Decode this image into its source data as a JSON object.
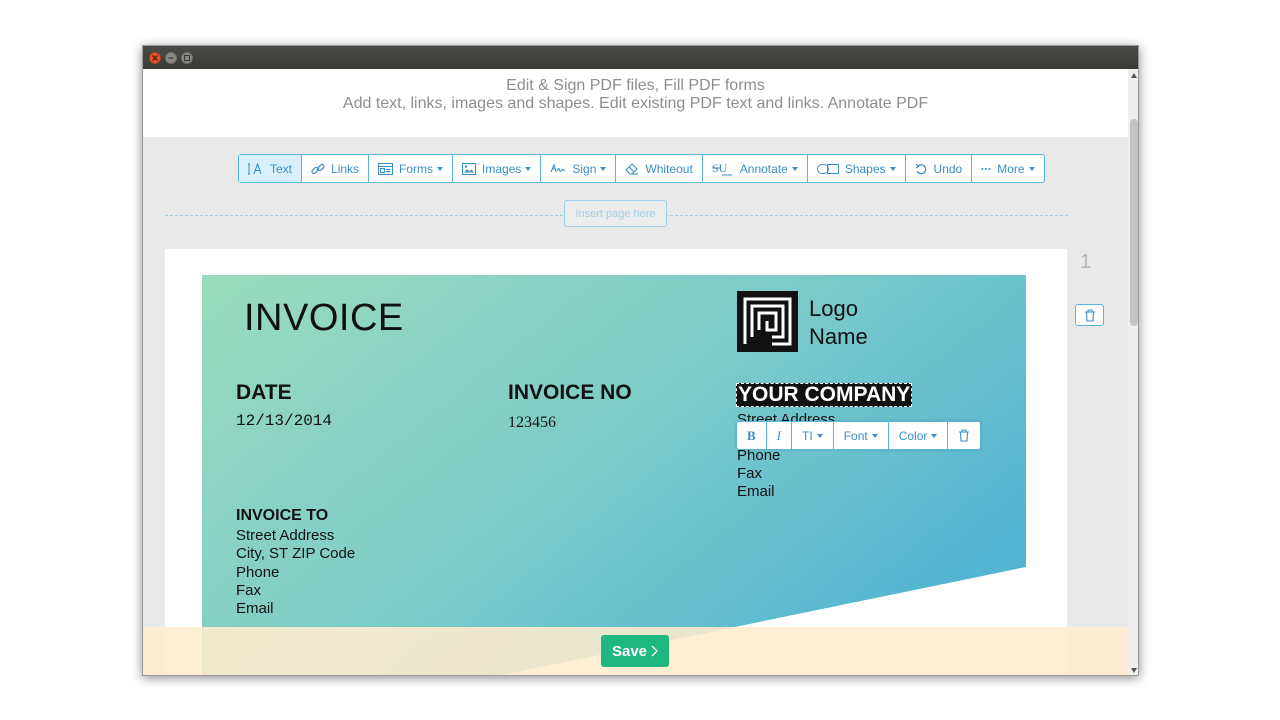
{
  "header": {
    "line1": "Edit & Sign PDF files, Fill PDF forms",
    "line2": "Add text, links, images and shapes. Edit existing PDF text and links. Annotate PDF"
  },
  "toolbar": {
    "text": "Text",
    "links": "Links",
    "forms": "Forms",
    "images": "Images",
    "sign": "Sign",
    "whiteout": "Whiteout",
    "annotate": "Annotate",
    "shapes": "Shapes",
    "undo": "Undo",
    "more": "More"
  },
  "insert_page": "Insert page here",
  "page": {
    "number": "1"
  },
  "invoice": {
    "title": "INVOICE",
    "logo_line1": "Logo",
    "logo_line2": "Name",
    "date_label": "DATE",
    "date_value": "12/13/2014",
    "invoice_no_label": "INVOICE NO",
    "invoice_no_value": "123456",
    "company": "YOUR COMPANY",
    "company_street": "Street Address",
    "company_phone": "Phone",
    "company_fax": "Fax",
    "company_email": "Email",
    "invoice_to_label": "INVOICE TO",
    "to_street": "Street Address",
    "to_city": "City, ST ZIP Code",
    "to_phone": "Phone",
    "to_fax": "Fax",
    "to_email": "Email"
  },
  "format_bar": {
    "bold": "B",
    "italic": "I",
    "size": "TI",
    "font": "Font",
    "color": "Color"
  },
  "footer": {
    "save": "Save"
  },
  "colors": {
    "accent": "#3a8fc4",
    "save_green": "#1db77f",
    "gradient_start": "#9adbbd",
    "gradient_end": "#54b5d2",
    "footer_bg": "#fdeccf"
  }
}
